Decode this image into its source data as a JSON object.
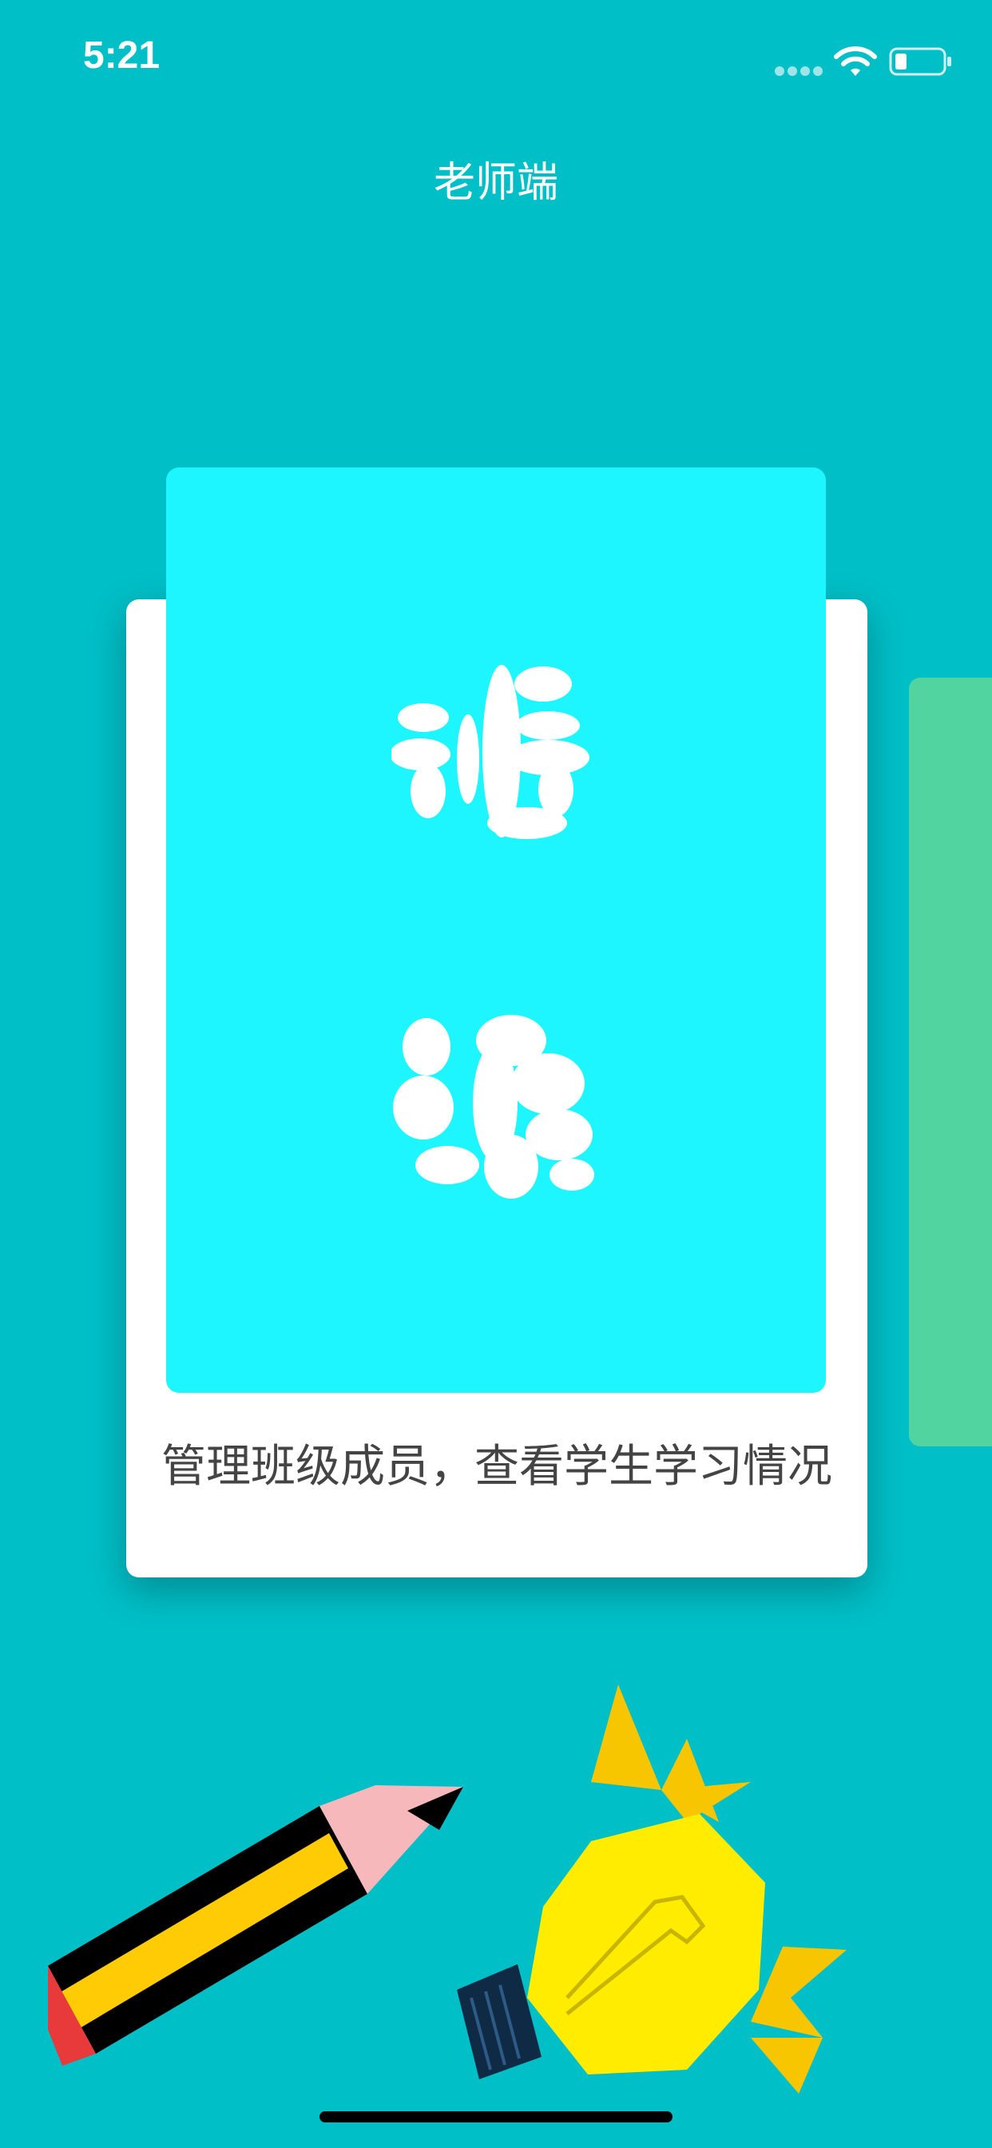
{
  "status_bar": {
    "time": "5:21"
  },
  "header": {
    "title": "老师端"
  },
  "card": {
    "cover_title_line1": "班",
    "cover_title_line2": "级",
    "description": "管理班级成员，查看学生学习情况"
  },
  "colors": {
    "background": "#00BFC7",
    "card_cover": "#1DF6FF",
    "side_card": "#52D4A1",
    "card_text": "#444444"
  },
  "icons": [
    "wifi-icon",
    "battery-icon",
    "pencil-illustration",
    "lightbulb-illustration"
  ]
}
